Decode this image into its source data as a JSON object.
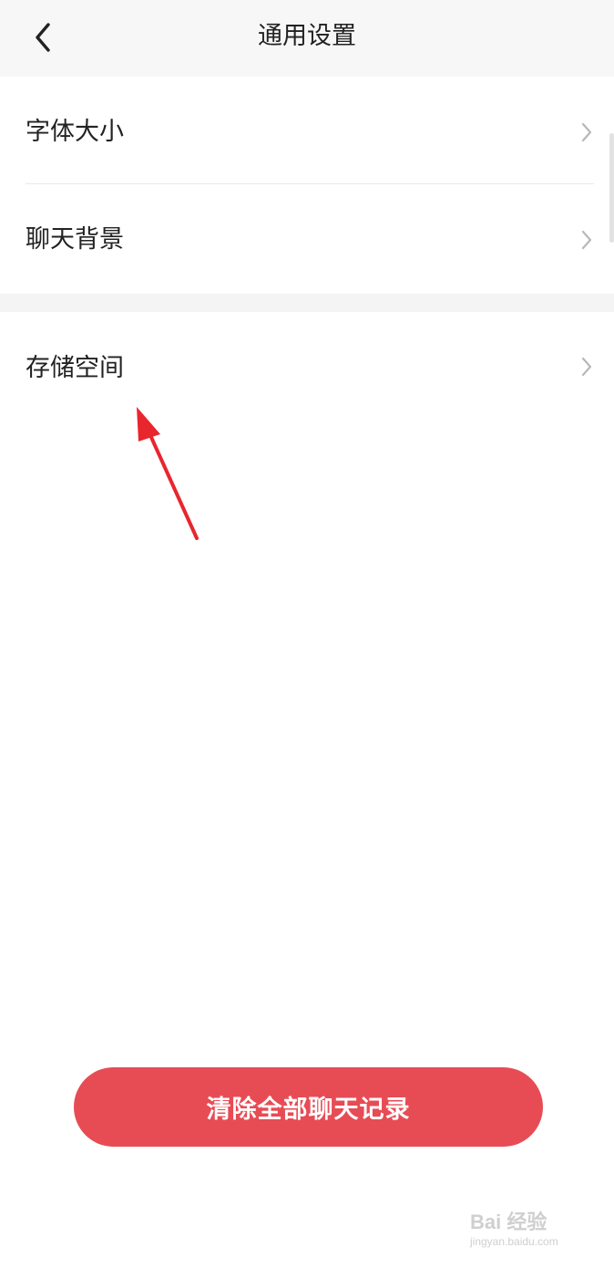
{
  "header": {
    "title": "通用设置",
    "back_icon": "chevron-left-icon"
  },
  "settings_group_1": {
    "items": [
      {
        "label": "字体大小",
        "icon": "chevron-right-icon"
      },
      {
        "label": "聊天背景",
        "icon": "chevron-right-icon"
      }
    ]
  },
  "settings_group_2": {
    "items": [
      {
        "label": "存储空间",
        "icon": "chevron-right-icon"
      }
    ]
  },
  "actions": {
    "clear_all_label": "清除全部聊天记录"
  },
  "watermark": {
    "logo_text": "Bai 经验",
    "sub_text": "jingyan.baidu.com"
  },
  "colors": {
    "header_bg": "#f7f7f7",
    "separator_bg": "#f4f4f4",
    "primary_button": "#e74c55",
    "annotation_arrow": "#e8262e",
    "chevron": "#b8b8b8"
  }
}
